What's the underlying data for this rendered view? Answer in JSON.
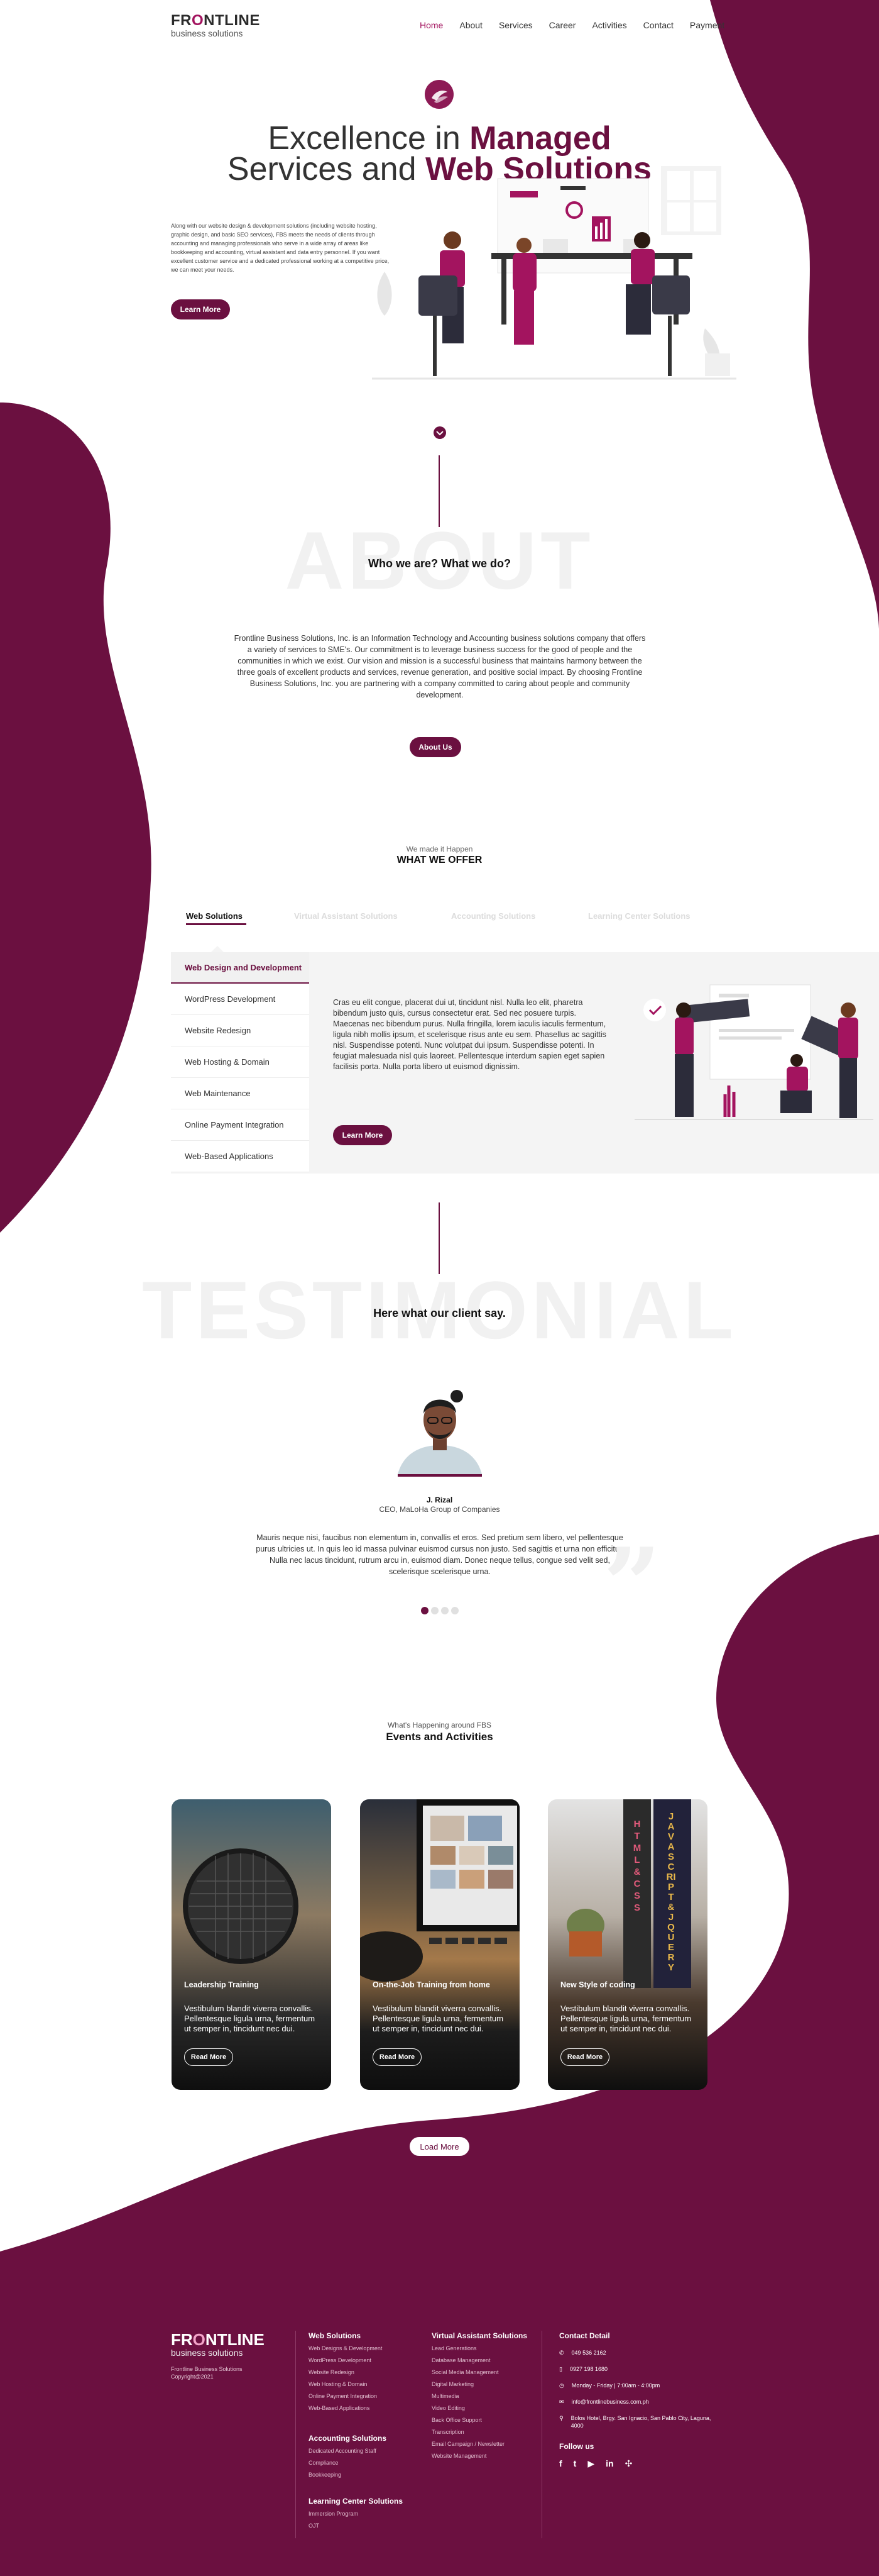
{
  "brand": {
    "logo_pre": "FR",
    "logo_o": "O",
    "logo_post": "NTLINE",
    "logo_sub": "business solutions"
  },
  "nav": {
    "items": [
      "Home",
      "About",
      "Services",
      "Career",
      "Activities",
      "Contact",
      "Payment"
    ],
    "active": "Home"
  },
  "hero": {
    "line1_plain": "Excellence in ",
    "line1_bold": "Managed",
    "line2_plain": "Services and ",
    "line2_bold": "Web Solutions",
    "description": "Along with our website design & development solutions (including website hosting, graphic design, and basic SEO services), FBS meets the needs of clients through accounting and managing professionals who serve in a wide array of areas like bookkeeping and accounting, virtual assistant and data entry personnel. If you want excellent customer service and a dedicated professional working at a competitive price, we can meet your needs.",
    "cta": "Learn More"
  },
  "about": {
    "ghost": "ABOUT",
    "heading": "Who we are? What we do?",
    "body": "Frontline Business Solutions, Inc. is an Information Technology and Accounting business solutions company that offers a variety of services to SME's. Our commitment is to leverage business success for the good of people and the communities in which we exist. Our vision and mission is a successful business that maintains harmony between the three goals of excellent products and services, revenue generation, and positive social impact. By choosing Frontline Business Solutions, Inc. you are partnering with a company committed to caring about people and community development.",
    "cta": "About Us"
  },
  "offer": {
    "kicker": "We made it Happen",
    "heading": "WHAT WE OFFER",
    "tabs": [
      "Web Solutions",
      "Virtual Assistant Solutions",
      "Accounting Solutions",
      "Learning Center Solutions"
    ],
    "menu": [
      "Web Design and Development",
      "WordPress Development",
      "Website Redesign",
      "Web Hosting & Domain",
      "Web Maintenance",
      "Online Payment Integration",
      "Web-Based Applications"
    ],
    "body": "Cras eu elit congue, placerat dui ut, tincidunt nisl. Nulla leo elit, pharetra bibendum justo quis, cursus consectetur erat. Sed nec posuere turpis. Maecenas nec bibendum purus. Nulla fringilla, lorem iaculis iaculis fermentum, ligula nibh mollis ipsum, et scelerisque risus ante eu sem. Phasellus ac sagittis nisl. Suspendisse potenti. Nunc volutpat dui ipsum. Suspendisse potenti. In feugiat malesuada nisl quis laoreet. Pellentesque interdum sapien eget sapien facilisis porta. Nulla porta libero ut euismod dignissim.",
    "cta": "Learn More"
  },
  "testimonial": {
    "ghost": "TESTIMONIAL",
    "heading": "Here what our client say.",
    "name": "J. Rizal",
    "role": "CEO, MaLoHa Group of Companies",
    "quote": "Mauris neque nisi, faucibus non elementum in, convallis et eros. Sed pretium sem libero, vel pellentesque purus ultricies ut. In quis leo id massa pulvinar euismod cursus non justo. Sed sagittis et urna non efficitur. Nulla nec lacus tincidunt, rutrum arcu in, euismod diam. Donec neque tellus, congue sed velit sed, scelerisque scelerisque urna.",
    "quote_mark": "”"
  },
  "events": {
    "kicker": "What's Happening around FBS",
    "heading": "Events and Activities",
    "cards": [
      {
        "title": "Leadership Training",
        "text": "Vestibulum blandit viverra convallis. Pellentesque ligula urna, fermentum ut semper in, tincidunt nec dui.",
        "cta": "Read More"
      },
      {
        "title": "On-the-Job Training from home",
        "text": "Vestibulum blandit viverra convallis. Pellentesque ligula urna, fermentum ut semper in, tincidunt nec dui.",
        "cta": "Read More"
      },
      {
        "title": "New Style of coding",
        "text": "Vestibulum blandit viverra convallis. Pellentesque ligula urna, fermentum ut semper in, tincidunt nec dui.",
        "cta": "Read More"
      }
    ],
    "book1": "HTML&CSS",
    "book2": "JAVASCRIPT&JQUERY",
    "load_more": "Load More"
  },
  "footer": {
    "company": "Frontline Business Solutions",
    "copyright": "Copyright@2021",
    "web": {
      "heading": "Web Solutions",
      "items": [
        "Web Designs & Development",
        "WordPress Development",
        "Website Redesign",
        "Web Hosting & Domain",
        "Online Payment Integration",
        "Web-Based Applications"
      ]
    },
    "accounting": {
      "heading": "Accounting Solutions",
      "items": [
        "Dedicated Accounting Staff",
        "Compliance",
        "Bookkeeping"
      ]
    },
    "learning": {
      "heading": "Learning Center Solutions",
      "items": [
        "Immersion Program",
        "OJT"
      ]
    },
    "va": {
      "heading": "Virtual Assistant Solutions",
      "items": [
        "Lead Generations",
        "Database Management",
        "Social Media Management",
        "Digital Marketing",
        "Multimedia",
        "Video Editing",
        "Back Office Support",
        "Transcription",
        "Email Campaign / Newsletter",
        "Website Management"
      ]
    },
    "contact": {
      "heading": "Contact Detail",
      "phone": "049 536 2162",
      "mobile": "0927 198 1680",
      "hours": "Monday - Friday | 7:00am - 4:00pm",
      "email": "info@frontlinebusiness.com.ph",
      "address": "Bolos Hotel, Brgy. San Ignacio, San Pablo City, Laguna, 4000"
    },
    "follow": "Follow us",
    "social": [
      "f",
      "t",
      "▶",
      "in",
      "✣"
    ]
  },
  "colors": {
    "brand": "#6b1040",
    "accent": "#a3145f"
  }
}
